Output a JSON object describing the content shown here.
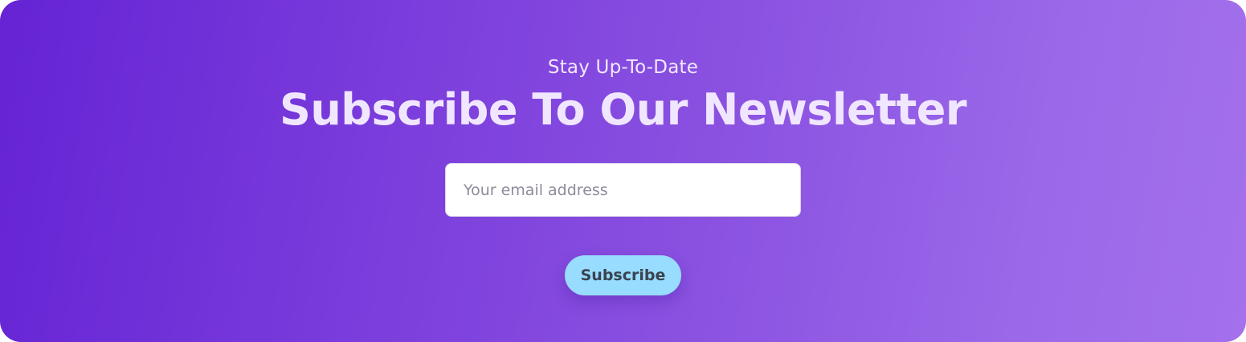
{
  "newsletter": {
    "eyebrow": "Stay Up-To-Date",
    "title": "Subscribe To Our Newsletter",
    "email_placeholder": "Your email address",
    "email_value": "",
    "subscribe_label": "Subscribe"
  },
  "colors": {
    "gradient_start": "#6523d4",
    "gradient_end": "#a470ec",
    "title_text": "#f1e6ff",
    "button_background": "#98dcff",
    "button_text": "#3b4350"
  }
}
